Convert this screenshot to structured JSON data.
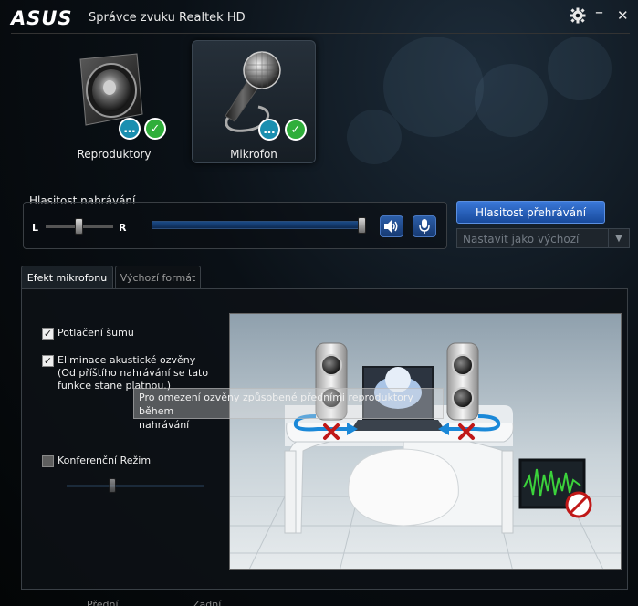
{
  "window": {
    "logo_text": "ASUS",
    "title": "Správce zvuku Realtek HD",
    "settings_icon": "gear-icon",
    "minimize_glyph": "–",
    "close_glyph": "✕"
  },
  "devices": [
    {
      "label": "Reproduktory",
      "icon": "speaker-icon",
      "selected": false
    },
    {
      "label": "Mikrofon",
      "icon": "microphone-icon",
      "selected": true
    }
  ],
  "recording_volume": {
    "label": "Hlasitost nahrávání",
    "left_label": "L",
    "right_label": "R",
    "balance": 0.5,
    "level": 1.0
  },
  "playback_button": "Hlasitost přehrávání",
  "default_select": {
    "value": "Nastavit jako výchozí"
  },
  "tabs": [
    {
      "label": "Efekt mikrofonu",
      "active": true
    },
    {
      "label": "Výchozí formát",
      "active": false
    }
  ],
  "effects": {
    "noise_suppression": {
      "label": "Potlačení šumu",
      "checked": true
    },
    "echo_cancellation": {
      "line1": "Eliminace akustické ozvěny",
      "line2": "(Od příštího nahrávání se tato",
      "line3": "funkce stane platnou.)",
      "checked": true
    },
    "conference_mode": {
      "label": "Konferenční Režim",
      "checked": false,
      "level": 0.33
    }
  },
  "tooltip": {
    "line1": "Pro omezení ozvěny způsobené předními reproduktory během",
    "line2": "nahrávání"
  },
  "bottom_labels": [
    "Přední",
    "Zadní"
  ],
  "colors": {
    "accent_blue": "#2c5ea8",
    "ok_green": "#2fae3a",
    "chat_blue": "#1a8fb0",
    "error_red": "#d02020"
  }
}
